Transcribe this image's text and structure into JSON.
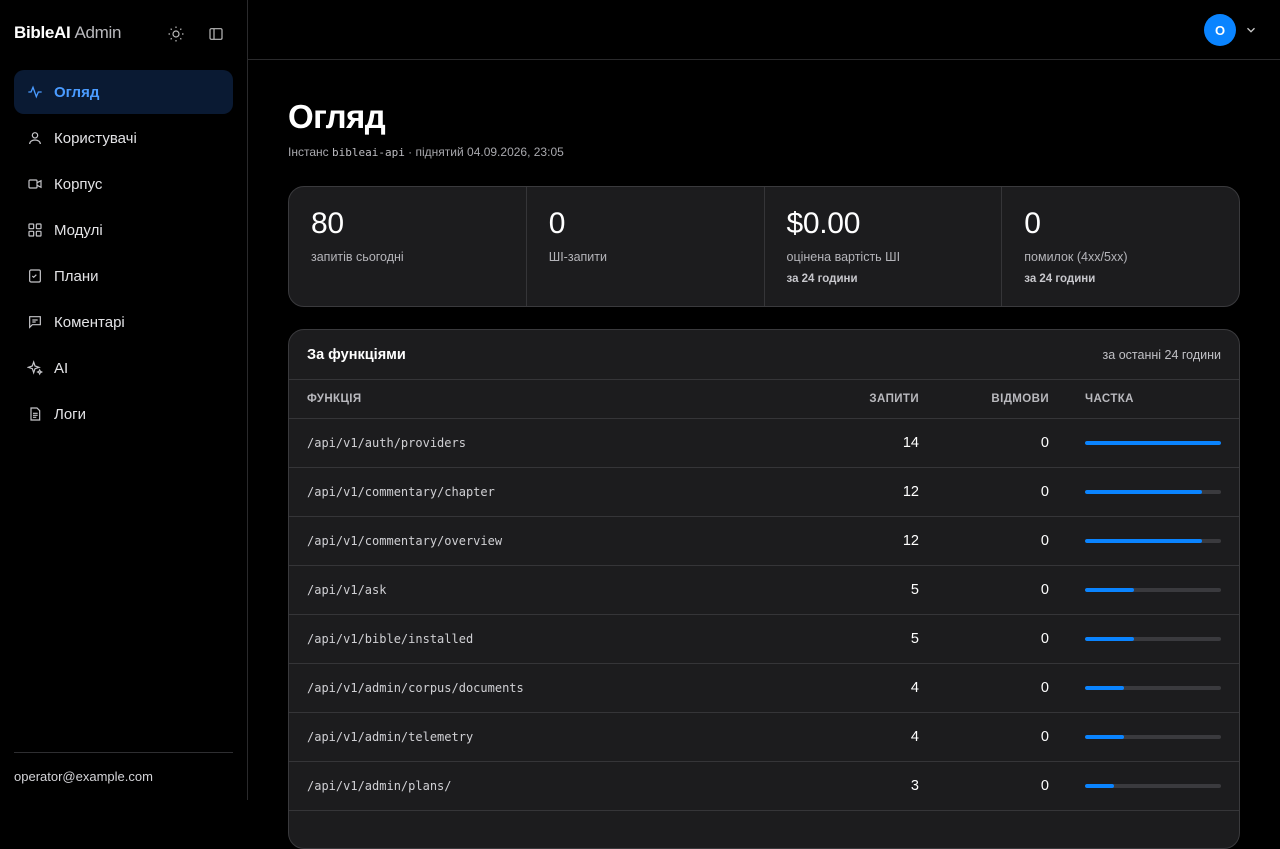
{
  "brand": {
    "name": "BibleAI",
    "sub": "Admin"
  },
  "sidebar": {
    "items": [
      {
        "label": "Огляд",
        "icon": "activity-icon",
        "active": true
      },
      {
        "label": "Користувачі",
        "icon": "user-icon"
      },
      {
        "label": "Корпус",
        "icon": "video-icon"
      },
      {
        "label": "Модулі",
        "icon": "grid-icon"
      },
      {
        "label": "Плани",
        "icon": "checklist-icon"
      },
      {
        "label": "Коментарі",
        "icon": "comment-icon"
      },
      {
        "label": "AI",
        "icon": "sparkles-icon"
      },
      {
        "label": "Логи",
        "icon": "document-icon"
      }
    ],
    "footer_email": "operator@example.com"
  },
  "header": {
    "avatar_initial": "O"
  },
  "page": {
    "title": "Огляд",
    "sub_prefix": "Інстанс",
    "instance": "bibleai-api",
    "sub_suffix": "· піднятий 04.09.2026, 23:05"
  },
  "stats": [
    {
      "value": "80",
      "label": "запитів сьогодні",
      "note": ""
    },
    {
      "value": "0",
      "label": "ШІ-запити",
      "note": ""
    },
    {
      "value": "$0.00",
      "label": "оцінена вартість ШІ",
      "note": "за 24 години"
    },
    {
      "value": "0",
      "label": "помилок (4xx/5xx)",
      "note": "за 24 години"
    }
  ],
  "table": {
    "title": "За функціями",
    "period": "за останні 24 години",
    "columns": {
      "function": "ФУНКЦІЯ",
      "requests": "ЗАПИТИ",
      "rejections": "ВІДМОВИ",
      "share": "ЧАСТКА"
    },
    "rows": [
      {
        "function": "/api/v1/auth/providers",
        "requests": "14",
        "rejections": "0",
        "share": 1.0
      },
      {
        "function": "/api/v1/commentary/chapter",
        "requests": "12",
        "rejections": "0",
        "share": 0.857
      },
      {
        "function": "/api/v1/commentary/overview",
        "requests": "12",
        "rejections": "0",
        "share": 0.857
      },
      {
        "function": "/api/v1/ask",
        "requests": "5",
        "rejections": "0",
        "share": 0.357
      },
      {
        "function": "/api/v1/bible/installed",
        "requests": "5",
        "rejections": "0",
        "share": 0.357
      },
      {
        "function": "/api/v1/admin/corpus/documents",
        "requests": "4",
        "rejections": "0",
        "share": 0.286
      },
      {
        "function": "/api/v1/admin/telemetry",
        "requests": "4",
        "rejections": "0",
        "share": 0.286
      },
      {
        "function": "/api/v1/admin/plans/",
        "requests": "3",
        "rejections": "0",
        "share": 0.214
      }
    ]
  },
  "colors": {
    "accent": "#0a84ff",
    "active_bg": "#0a1a33",
    "card_bg": "#1c1c1e"
  }
}
